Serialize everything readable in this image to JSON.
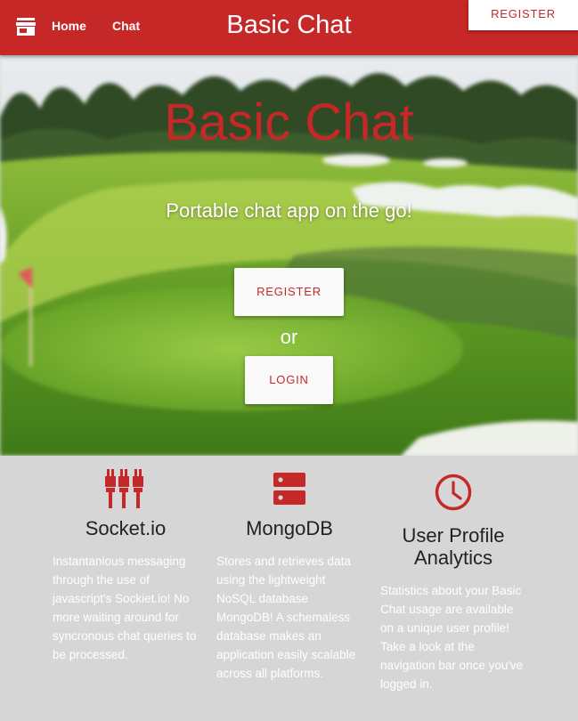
{
  "nav": {
    "home_label": "Home",
    "chat_label": "Chat",
    "brand": "Basic Chat",
    "register_label": "REGISTER",
    "accent_color": "#c62828"
  },
  "hero": {
    "title": "Basic Chat",
    "subtitle": "Portable chat app on the go!",
    "register_label": "REGISTER",
    "or_text": "or",
    "login_label": "LOGIN"
  },
  "features": [
    {
      "icon": "socket-plugs-icon",
      "title": "Socket.io",
      "description": "Instantanious messaging through the use of javascript's Sockiet.io! No more waiting around for syncronous chat queries to be processed."
    },
    {
      "icon": "database-server-icon",
      "title": "MongoDB",
      "description": "Stores and retrieves data using the lightweight NoSQL database MongoDB! A schemaless database makes an application easily scalable across all platforms."
    },
    {
      "icon": "clock-icon",
      "title": "User Profile Analytics",
      "description": "Statistics about your Basic Chat usage are available on a unique user profile! Take a look at the navigation bar once you've logged in."
    }
  ]
}
